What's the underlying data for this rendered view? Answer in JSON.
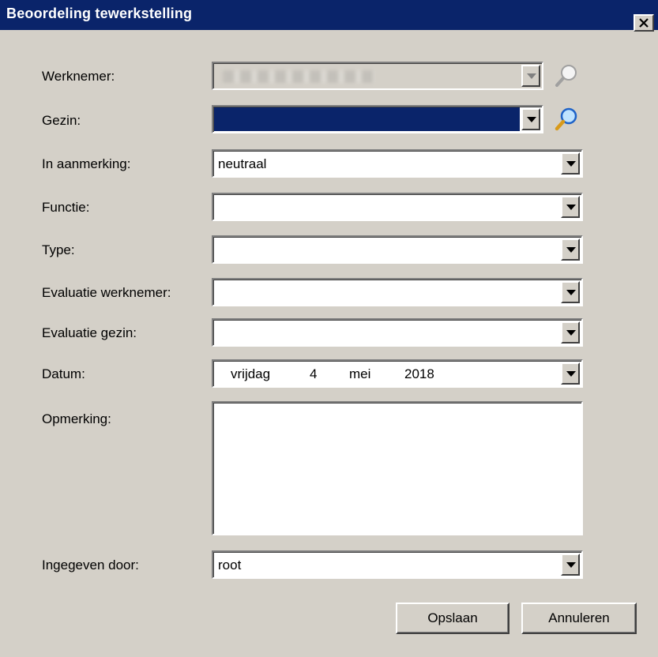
{
  "window": {
    "title": "Beoordeling tewerkstelling"
  },
  "fields": {
    "werknemer": {
      "label": "Werknemer:",
      "value": ""
    },
    "gezin": {
      "label": "Gezin:",
      "value": ""
    },
    "in_aanmerking": {
      "label": "In aanmerking:",
      "value": "neutraal"
    },
    "functie": {
      "label": "Functie:",
      "value": ""
    },
    "type": {
      "label": "Type:",
      "value": ""
    },
    "evaluatie_werknemer": {
      "label": "Evaluatie werknemer:",
      "value": ""
    },
    "evaluatie_gezin": {
      "label": "Evaluatie gezin:",
      "value": ""
    },
    "datum": {
      "label": "Datum:",
      "weekday": "vrijdag",
      "day": "4",
      "month": "mei",
      "year": "2018"
    },
    "opmerking": {
      "label": "Opmerking:",
      "value": ""
    },
    "ingegeven_door": {
      "label": "Ingegeven door:",
      "value": "root"
    }
  },
  "buttons": {
    "save": "Opslaan",
    "cancel": "Annuleren"
  },
  "icons": {
    "close": "close-icon",
    "werknemer_search": "magnifier-icon-disabled",
    "gezin_search": "magnifier-icon"
  },
  "colors": {
    "titlebar": "#0a246a",
    "window": "#d4d0c8",
    "selection": "#0a246a"
  }
}
